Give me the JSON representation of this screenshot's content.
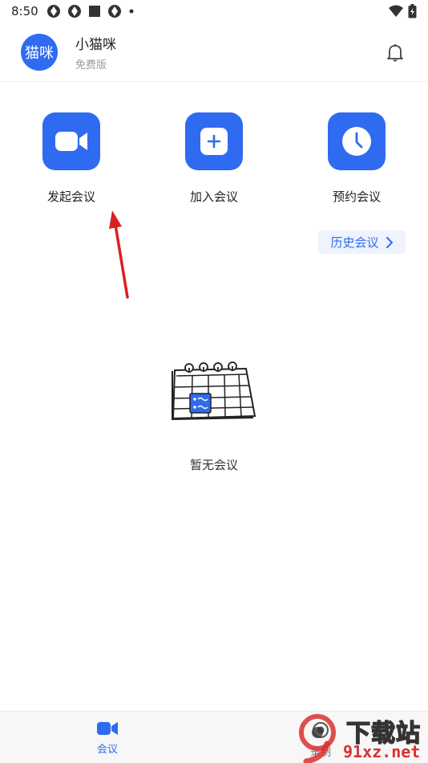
{
  "status_bar": {
    "time": "8:50"
  },
  "header": {
    "avatar_text": "猫咪",
    "user_name": "小猫咪",
    "plan": "免费版"
  },
  "actions": [
    {
      "label": "发起会议",
      "icon": "video-camera-icon"
    },
    {
      "label": "加入会议",
      "icon": "plus-icon"
    },
    {
      "label": "预约会议",
      "icon": "clock-icon"
    }
  ],
  "history": {
    "label": "历史会议"
  },
  "empty_state": {
    "text": "暂无会议",
    "illustration": "calendar-illustration"
  },
  "bottom_nav": [
    {
      "label": "会议",
      "icon": "video-camera-icon",
      "active": true
    },
    {
      "label": "录制",
      "icon": "record-icon",
      "active": false
    }
  ],
  "watermark": {
    "title": "下载站",
    "site": "91xz.net"
  },
  "colors": {
    "accent": "#2f6bf0",
    "annotation": "#d92020"
  }
}
